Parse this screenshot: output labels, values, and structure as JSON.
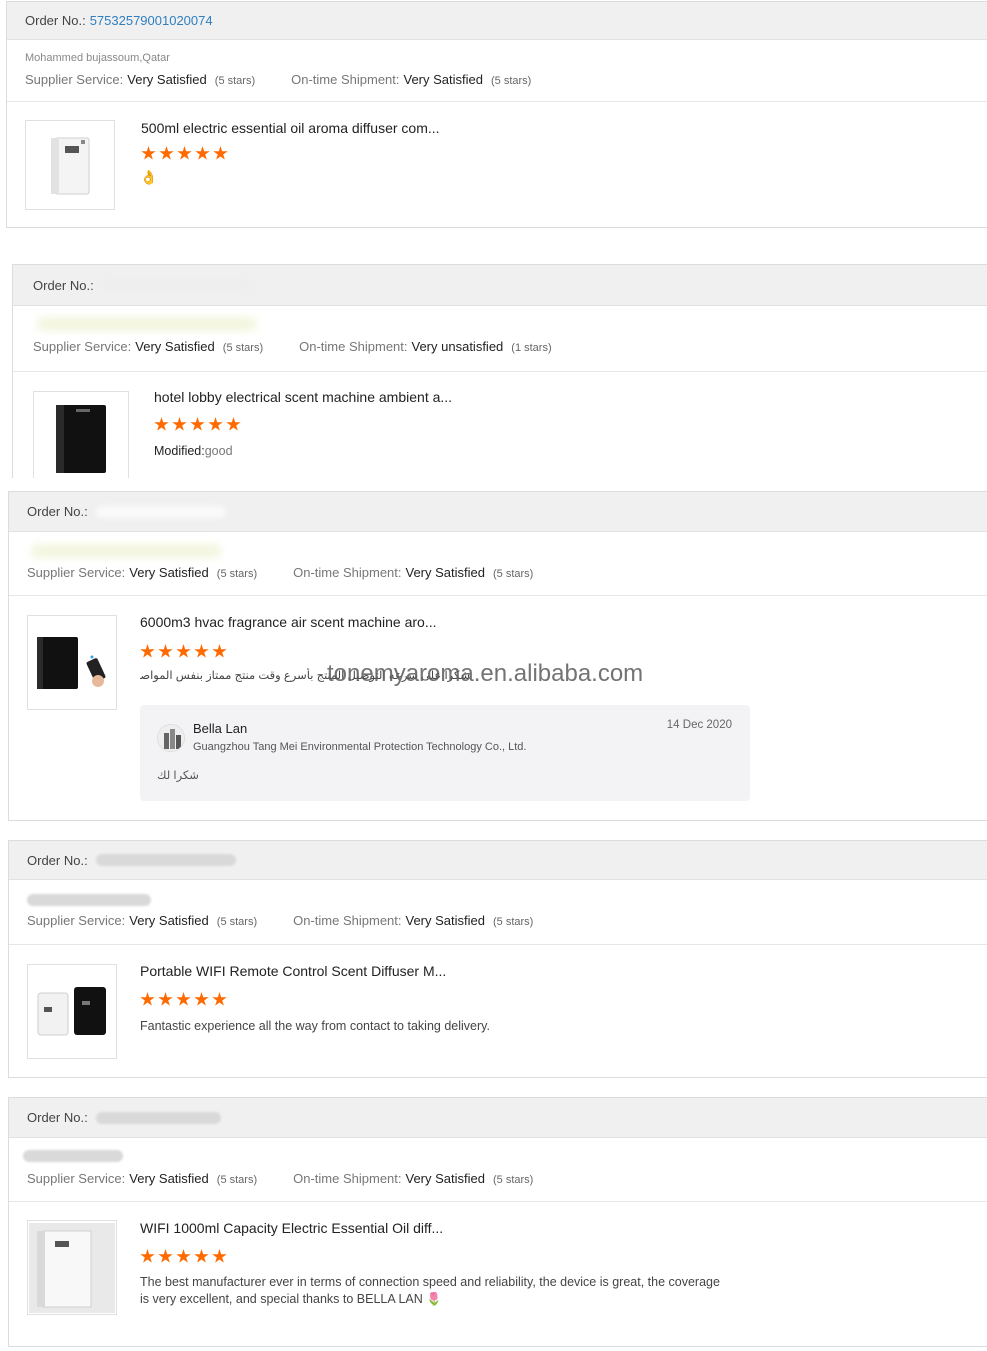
{
  "reviews": [
    {
      "order_label": "Order No.:",
      "order_number": "57532579001020074",
      "buyer": "Mohammed bujassoum,Qatar",
      "supplier_label": "Supplier Service:",
      "supplier_value": "Very Satisfied",
      "supplier_stars": "(5 stars)",
      "shipment_label": "On-time Shipment:",
      "shipment_value": "Very Satisfied",
      "shipment_stars": "(5 stars)",
      "product_title": "500ml electric essential oil aroma diffuser com...",
      "rating": 5,
      "review": "👌"
    },
    {
      "order_label": "Order No.:",
      "order_number": "",
      "buyer": "",
      "supplier_label": "Supplier Service:",
      "supplier_value": "Very Satisfied",
      "supplier_stars": "(5 stars)",
      "shipment_label": "On-time Shipment:",
      "shipment_value": "Very unsatisfied",
      "shipment_stars": "(1 stars)",
      "product_title": "hotel lobby electrical scent machine ambient a...",
      "rating": 5,
      "review_label": "Modified:",
      "review": "good"
    },
    {
      "order_label": "Order No.:",
      "order_number": "",
      "buyer": "",
      "supplier_label": "Supplier Service:",
      "supplier_value": "Very Satisfied",
      "supplier_stars": "(5 stars)",
      "shipment_label": "On-time Shipment:",
      "shipment_value": "Very Satisfied",
      "shipment_stars": "(5 stars)",
      "product_title": "6000m3 hvac fragrance air scent machine aro...",
      "rating": 5,
      "review": "شكرا على سرعه التوصيل المنتج بأسرع وقت منتج ممتاز بنفس المواصفات 👍",
      "reply": {
        "name": "Bella Lan",
        "company": "Guangzhou Tang Mei Environmental Protection Technology Co., Ltd.",
        "date": "14 Dec 2020",
        "text": "شكرا لك"
      }
    },
    {
      "order_label": "Order No.:",
      "order_number": "",
      "buyer": "",
      "supplier_label": "Supplier Service:",
      "supplier_value": "Very Satisfied",
      "supplier_stars": "(5 stars)",
      "shipment_label": "On-time Shipment:",
      "shipment_value": "Very Satisfied",
      "shipment_stars": "(5 stars)",
      "product_title": "Portable WIFI Remote Control Scent Diffuser M...",
      "rating": 5,
      "review": "Fantastic experience all the way from contact to taking delivery."
    },
    {
      "order_label": "Order No.:",
      "order_number": "",
      "buyer": "",
      "supplier_label": "Supplier Service:",
      "supplier_value": "Very Satisfied",
      "supplier_stars": "(5 stars)",
      "shipment_label": "On-time Shipment:",
      "shipment_value": "Very Satisfied",
      "shipment_stars": "(5 stars)",
      "product_title": "WIFI 1000ml Capacity Electric Essential Oil diff...",
      "rating": 5,
      "review": "The best manufacturer ever in terms of connection speed and reliability, the device is great, the coverage is very excellent, and special thanks to BELLA LAN 🌷"
    }
  ],
  "watermark": "tonemyaroma.en.alibaba.com",
  "colors": {
    "star": "#ff6a00",
    "link": "#2f7fc1",
    "header_bg": "#f0f0f0"
  }
}
